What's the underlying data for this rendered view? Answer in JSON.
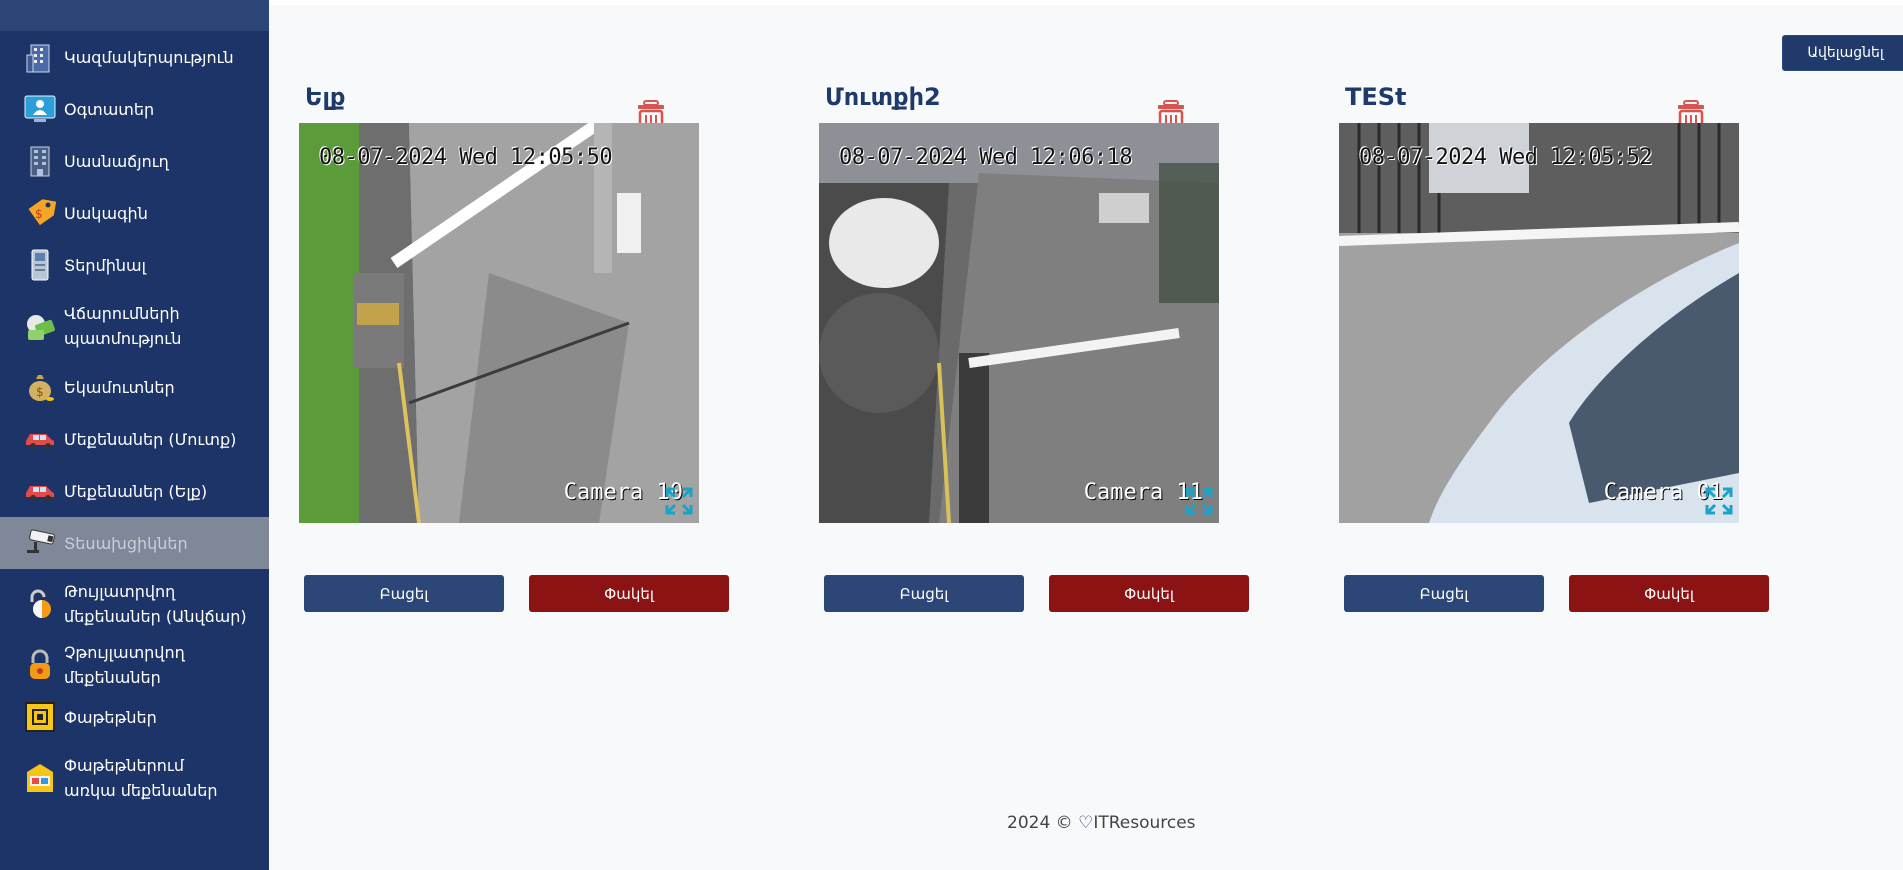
{
  "sidebar": {
    "items": [
      {
        "label": "Կազմակերպություն",
        "icon": "building-icon"
      },
      {
        "label": "Օգտատեր",
        "icon": "user-icon"
      },
      {
        "label": "Սասնաճյուղ",
        "icon": "branch-building-icon"
      },
      {
        "label": "Սակագին",
        "icon": "tag-icon"
      },
      {
        "label": "Տերմինալ",
        "icon": "terminal-icon"
      },
      {
        "label": "Վճարումների պատմություն",
        "icon": "payment-history-icon"
      },
      {
        "label": "Եկամուտներ",
        "icon": "money-bag-icon"
      },
      {
        "label": "Մեքենաներ (Մուտք)",
        "icon": "car-icon"
      },
      {
        "label": "Մեքենաներ (Ելք)",
        "icon": "car-icon"
      },
      {
        "label": "Տեսախցիկներ",
        "icon": "camera-icon",
        "active": true
      },
      {
        "label": "Թույլատրվող մեքենաներ (Անվճար)",
        "icon": "unlock-icon"
      },
      {
        "label": "Չթույլատրվող մեքենաներ",
        "icon": "lock-icon"
      },
      {
        "label": "Փաթեթներ",
        "icon": "package-icon"
      },
      {
        "label": "Փաթեթներում առկա մեքենաներ",
        "icon": "package-cars-icon"
      }
    ]
  },
  "main": {
    "add_label": "Ավելացնել",
    "cameras": [
      {
        "title": "Ելք",
        "datetime": "08-07-2024 Wed 12:05:50",
        "camera_label": "Camera 10",
        "open_label": "Բացել",
        "close_label": "Փակել"
      },
      {
        "title": "Մուտքի2",
        "datetime": "08-07-2024 Wed 12:06:18",
        "camera_label": "Camera 11",
        "open_label": "Բացել",
        "close_label": "Փակել"
      },
      {
        "title": "TESt",
        "datetime": "08-07-2024 Wed 12:05:52",
        "camera_label": "Camera 01",
        "open_label": "Բացել",
        "close_label": "Փակել"
      }
    ]
  },
  "footer": {
    "year": "2024 ©",
    "company": "ITResources"
  },
  "colors": {
    "sidebar": "#1c3467",
    "active_item": "#7e8898",
    "primary_button": "#2c4677",
    "danger_button": "#8b1313",
    "title": "#1e3a6a",
    "delete_icon": "#d9534f"
  }
}
